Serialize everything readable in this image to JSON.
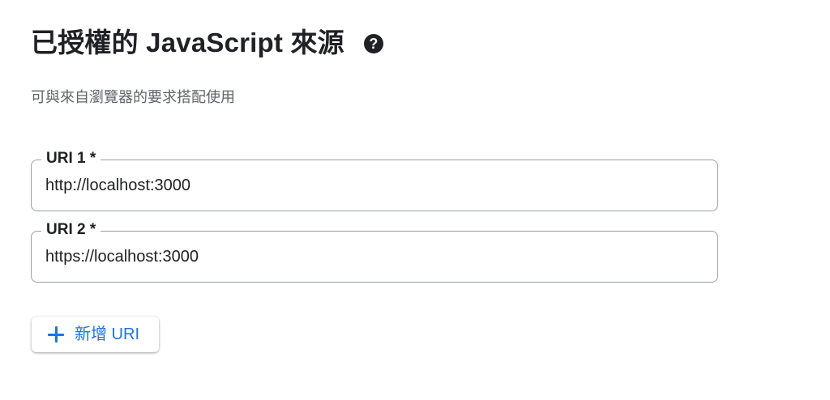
{
  "header": {
    "title": "已授權的 JavaScript 來源",
    "help_icon_glyph": "?",
    "subtitle": "可與來自瀏覽器的要求搭配使用"
  },
  "uris": [
    {
      "label": "URI 1 *",
      "value": "http://localhost:3000"
    },
    {
      "label": "URI 2 *",
      "value": "https://localhost:3000"
    }
  ],
  "add_button": {
    "label": "新增 URI",
    "icon": "plus-icon"
  },
  "colors": {
    "accent": "#1a73e8",
    "text": "#202124",
    "secondary_text": "#5f6368",
    "field_border": "#9aa0a6"
  }
}
